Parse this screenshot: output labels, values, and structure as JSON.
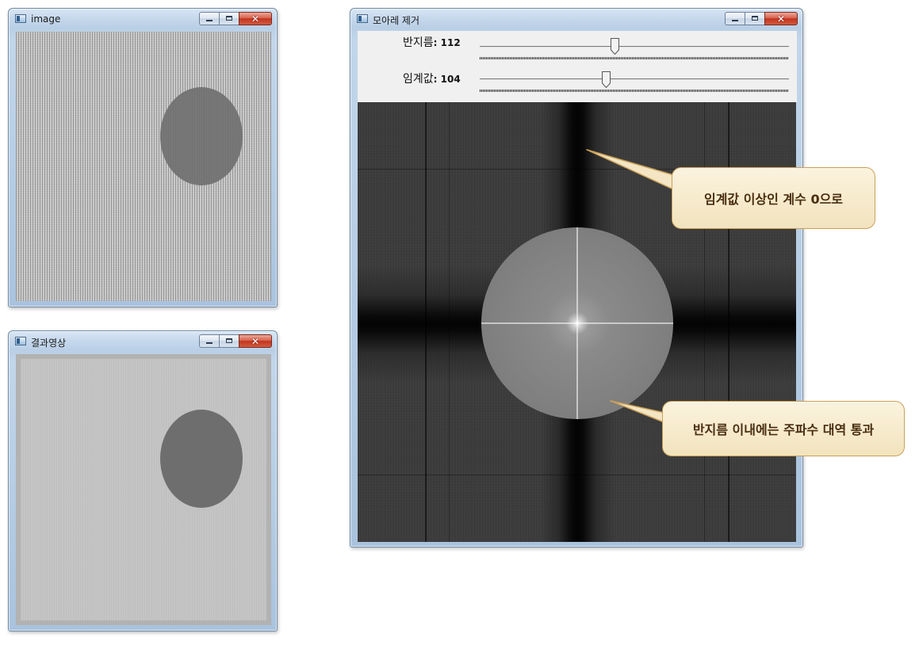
{
  "windows": {
    "image": {
      "title": "image",
      "buttons": {
        "minimize": "–",
        "maximize": "□",
        "close": "✕"
      }
    },
    "result": {
      "title": "결과영상",
      "buttons": {
        "minimize": "–",
        "maximize": "□",
        "close": "✕"
      }
    },
    "moire": {
      "title": "모아레 제거",
      "buttons": {
        "minimize": "–",
        "maximize": "□",
        "close": "✕"
      },
      "trackbars": [
        {
          "label": "반지름",
          "value": "112",
          "position": 0.44
        },
        {
          "label": "임계값",
          "value": "104",
          "position": 0.4
        }
      ]
    }
  },
  "callouts": {
    "threshold_note": "임계값 이상인 계수 0으로",
    "radius_note": "반지름 이내에는 주파수 대역 통과"
  },
  "colors": {
    "titlebar": "#c6d8ec",
    "close_button": "#c2341f",
    "callout_fill": "#f6e9c8",
    "callout_border": "#c9a05a",
    "blob": "#6e6e6e"
  }
}
